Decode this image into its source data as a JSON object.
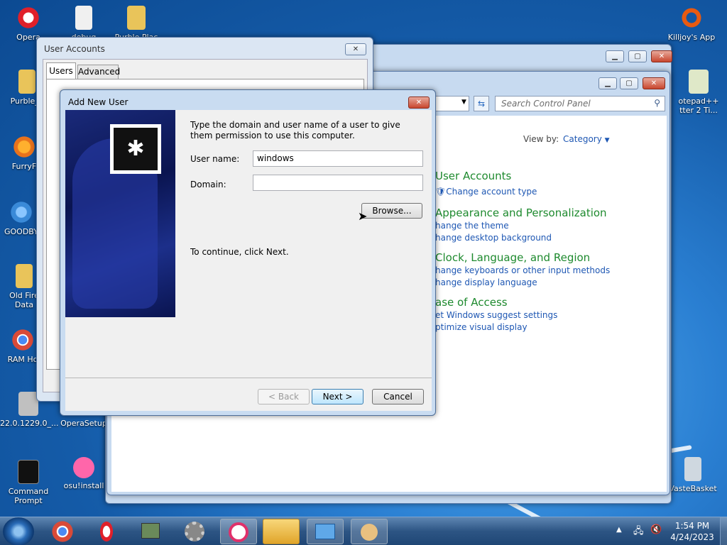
{
  "desktop": {
    "icons_left": [
      {
        "label": "Opera",
        "icon": "opera-icon",
        "color": "#e0202a"
      },
      {
        "label": "debug",
        "icon": "text-file-icon",
        "color": "#e8e8e8"
      },
      {
        "label": "Purble Plac",
        "icon": "folder-icon",
        "color": "#e9c45a"
      },
      {
        "label": "Purble_P",
        "icon": "folder-icon",
        "color": "#e9c45a"
      },
      {
        "label": "FurryF",
        "icon": "firefox-icon",
        "color": "#e8721c"
      },
      {
        "label": "GOODBY",
        "icon": "shortcut-icon",
        "color": "#3a8ad8"
      },
      {
        "label": "Old Fire\nData",
        "icon": "folder-icon",
        "color": "#e9c45a"
      },
      {
        "label": "RAM Ho",
        "icon": "chrome-icon",
        "color": "#d94a38"
      },
      {
        "label": "22.0.1229.0_...",
        "icon": "installer-icon",
        "color": "#c0c0c0"
      },
      {
        "label": "OperaSetup",
        "icon": "opera-setup-icon",
        "color": "#e0202a"
      },
      {
        "label": "Command\nPrompt",
        "icon": "cmd-icon",
        "color": "#111111"
      },
      {
        "label": "osu!install",
        "icon": "osu-icon",
        "color": "#ff66aa"
      }
    ],
    "icons_right": [
      {
        "label": "Killjoy's App",
        "icon": "killjoy-icon",
        "color": "#e85a10"
      },
      {
        "label": "otepad++\ntter 2 Ti...",
        "icon": "notepadpp-icon",
        "color": "#8bc34a"
      },
      {
        "label": "VasteBasket",
        "icon": "recycle-bin-icon",
        "color": "#cfd8e0"
      }
    ]
  },
  "user_accounts": {
    "title": "User Accounts",
    "tabs": [
      "Users",
      "Advanced"
    ],
    "close": "✕"
  },
  "control_panel": {
    "search_placeholder": "Search Control Panel",
    "view_by_label": "View by:",
    "view_by_value": "Category",
    "categories": [
      {
        "title": "User Accounts",
        "links": [
          "Change account type"
        ]
      },
      {
        "title": "Appearance and Personalization",
        "links": [
          "hange the theme",
          "hange desktop background"
        ]
      },
      {
        "title": "Clock, Language, and Region",
        "links": [
          "hange keyboards or other input methods",
          "hange display language"
        ]
      },
      {
        "title": "ase of Access",
        "links": [
          "et Windows suggest settings",
          "ptimize visual display"
        ]
      }
    ]
  },
  "dialog": {
    "title": "Add New User",
    "instruction": "Type the domain and user name of a user to give them permission to use this computer.",
    "username_label": "User name:",
    "username_value": "windows",
    "domain_label": "Domain:",
    "domain_value": "",
    "browse_label": "Browse...",
    "continue_text": "To continue, click Next.",
    "back_label": "< Back",
    "next_label": "Next >",
    "cancel_label": "Cancel"
  },
  "taskbar": {
    "time": "1:54 PM",
    "date": "4/24/2023",
    "apps": [
      "chrome-icon",
      "opera-icon",
      "network-app-icon",
      "settings-gear-icon",
      "opera-gx-icon",
      "explorer-icon",
      "control-panel-icon",
      "user-accounts-icon"
    ]
  }
}
